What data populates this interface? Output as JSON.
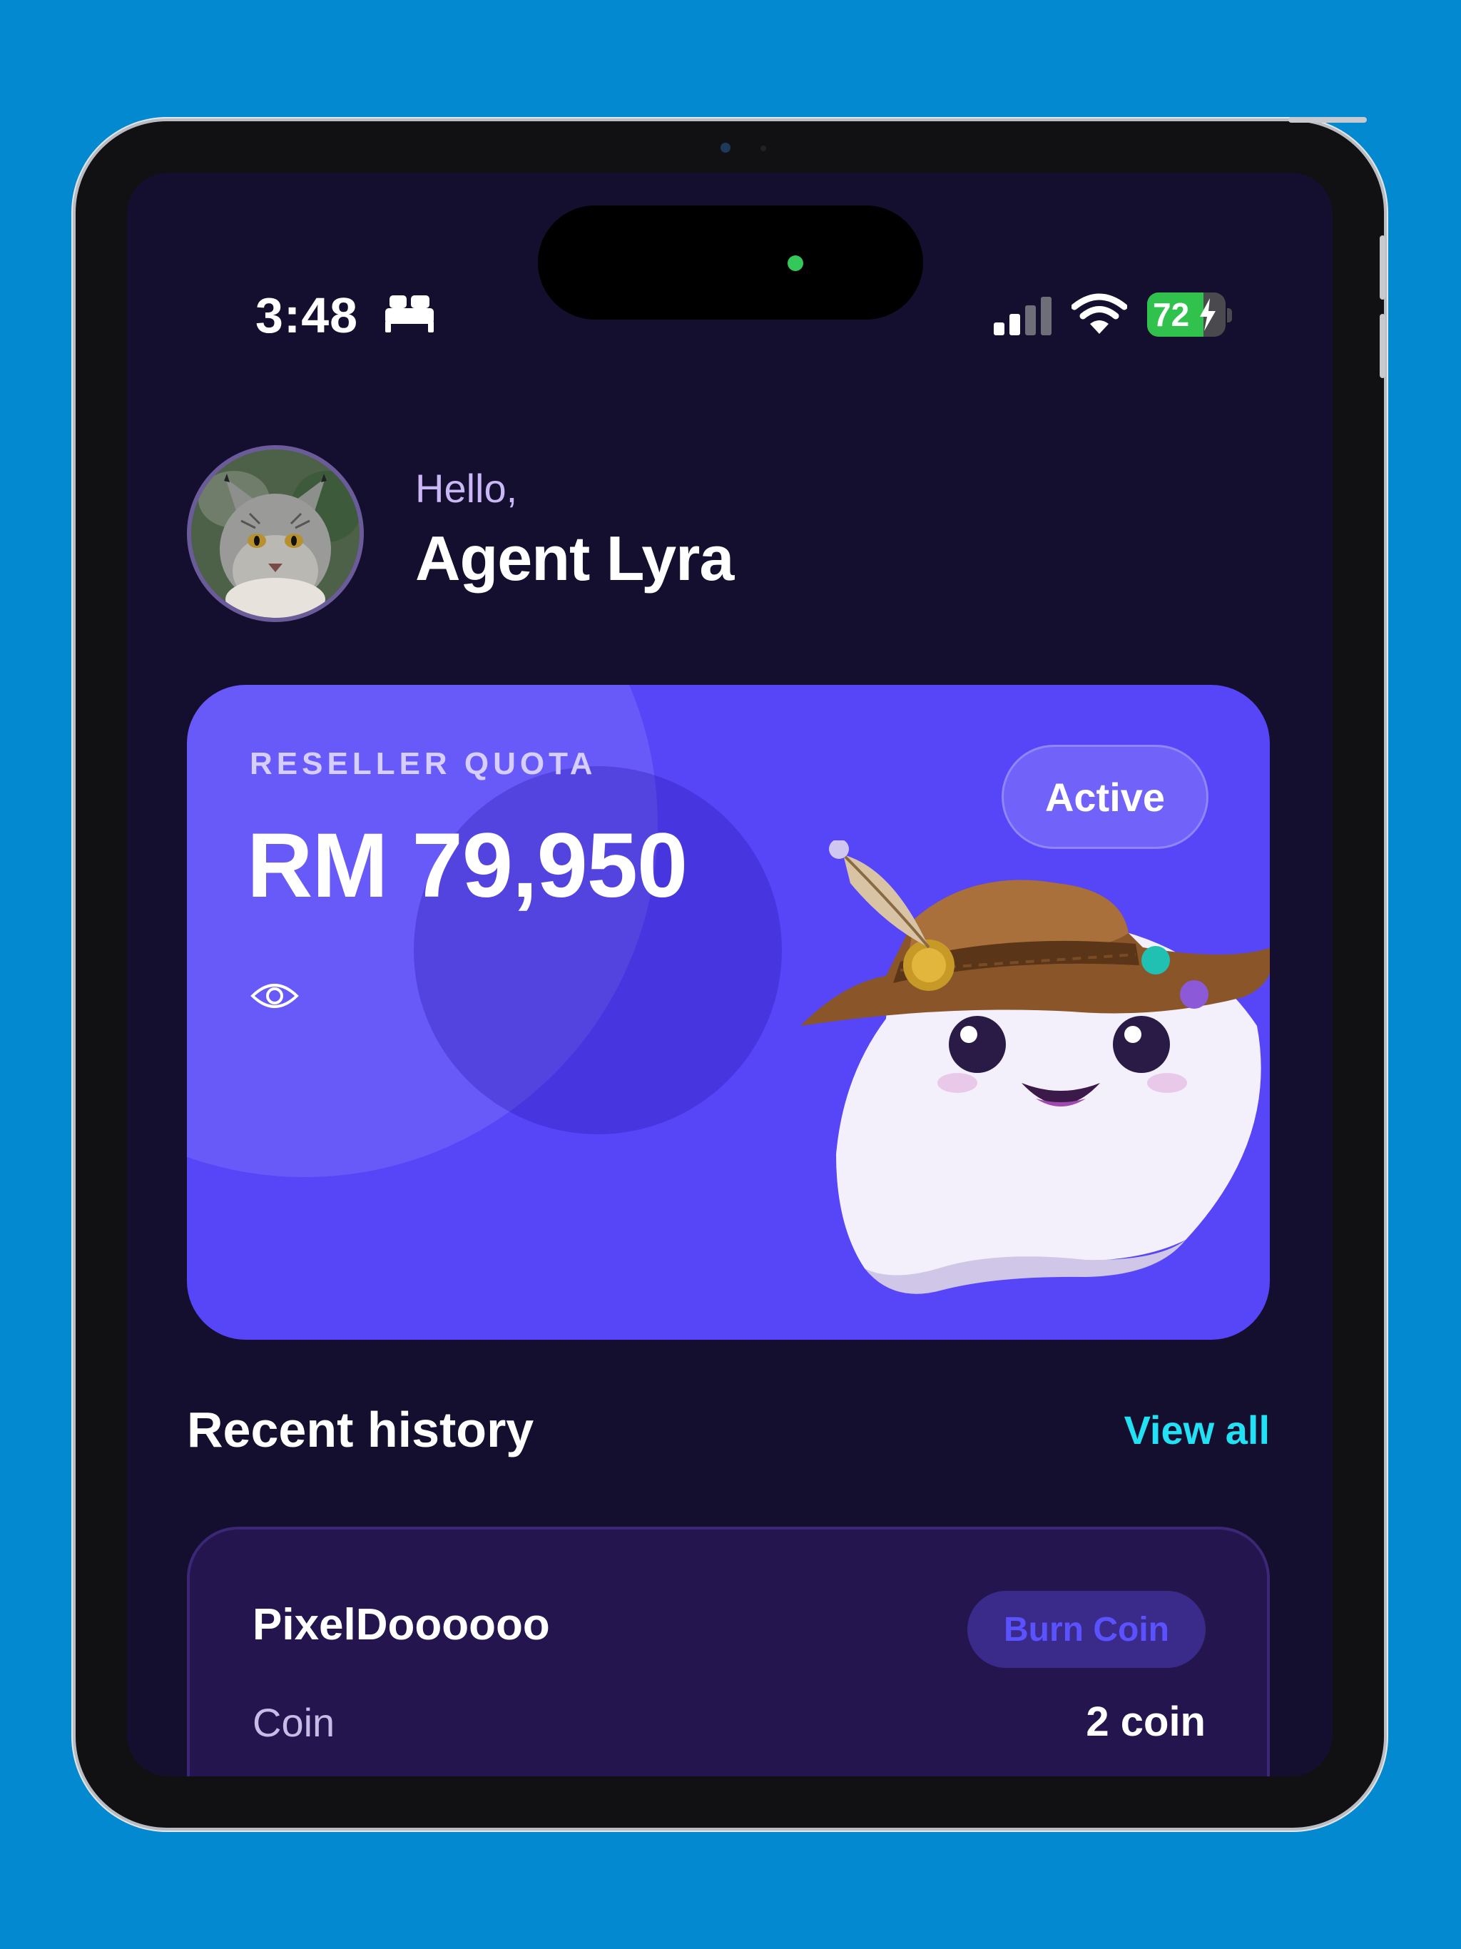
{
  "status_bar": {
    "time": "3:48",
    "battery_level": "72",
    "battery_fraction": 0.72,
    "signal_bars_active": 2,
    "signal_bars_total": 4,
    "icons": [
      "bed-icon",
      "signal-icon",
      "wifi-icon",
      "battery-icon",
      "charging-bolt-icon"
    ]
  },
  "header": {
    "greeting": "Hello,",
    "name": "Agent Lyra"
  },
  "quota_card": {
    "label": "RESELLER QUOTA",
    "amount": "RM 79,950",
    "status": "Active",
    "visibility_icon": "eye-icon",
    "accent_color": "#5646f8"
  },
  "recent_history": {
    "title": "Recent history",
    "view_all": "View all",
    "items": [
      {
        "name": "PixelDoooooo",
        "badge": "Burn Coin",
        "label": "Coin",
        "value": "2 coin"
      }
    ]
  },
  "colors": {
    "background": "#0389cf",
    "screen": "#140f2e",
    "link": "#22e1f5",
    "card": "#24154f"
  }
}
